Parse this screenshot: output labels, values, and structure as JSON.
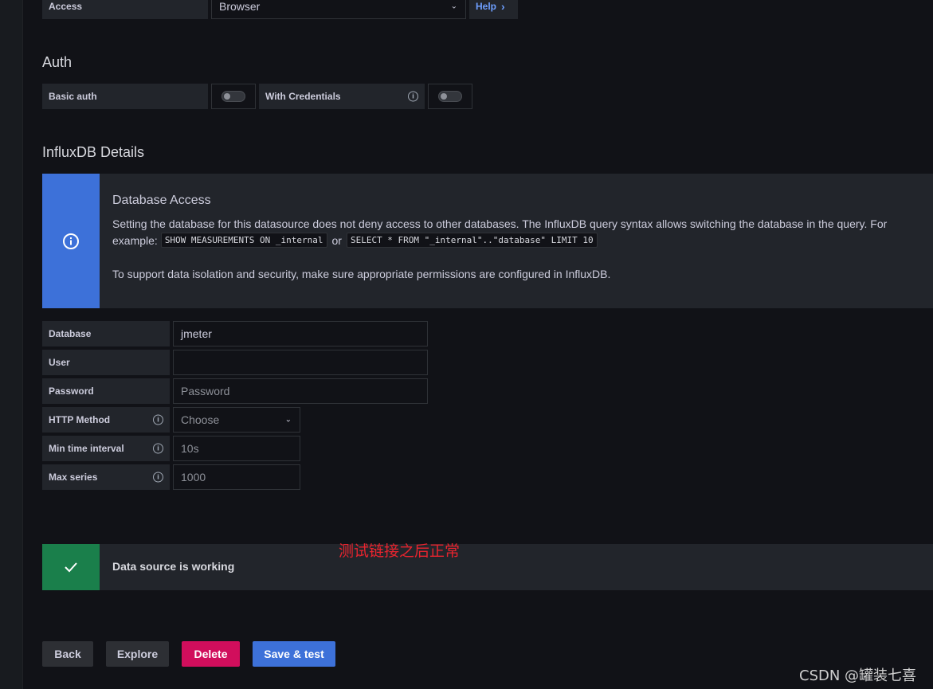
{
  "access": {
    "label": "Access",
    "value": "Browser",
    "help": "Help",
    "help_chevron": "›",
    "select_chevron": "⌄"
  },
  "auth": {
    "title": "Auth",
    "basic_auth_label": "Basic auth",
    "with_credentials_label": "With Credentials",
    "basic_auth_enabled": false,
    "with_credentials_enabled": false
  },
  "influx": {
    "title": "InfluxDB Details"
  },
  "notice": {
    "title": "Database Access",
    "line1": "Setting the database for this datasource does not deny access to other databases. The InfluxDB query syntax allows switching the database in the query. For",
    "example_prefix": "example:",
    "code1": "SHOW MEASUREMENTS ON _internal",
    "or": "or",
    "code2": "SELECT * FROM \"_internal\"..\"database\" LIMIT 10",
    "line2": "To support data isolation and security, make sure appropriate permissions are configured in InfluxDB.",
    "icon": "info-circle-icon",
    "color": "#3d71d9"
  },
  "fields": {
    "database": {
      "label": "Database",
      "value": "jmeter"
    },
    "user": {
      "label": "User",
      "value": ""
    },
    "password": {
      "label": "Password",
      "placeholder": "Password"
    },
    "http_method": {
      "label": "HTTP Method",
      "placeholder": "Choose"
    },
    "min_time_interval": {
      "label": "Min time interval",
      "placeholder": "10s"
    },
    "max_series": {
      "label": "Max series",
      "placeholder": "1000"
    }
  },
  "status": {
    "text": "Data source is working",
    "icon": "check-icon",
    "color": "#1a7f4b",
    "annotation": "测试链接之后正常"
  },
  "buttons": {
    "back": "Back",
    "explore": "Explore",
    "delete": "Delete",
    "save_test": "Save & test"
  },
  "watermark": "CSDN @罐装七喜",
  "colors": {
    "primary": "#3d71d9",
    "destructive": "#d10e5c",
    "secondary": "#2d2f34",
    "success": "#1a7f4b"
  }
}
